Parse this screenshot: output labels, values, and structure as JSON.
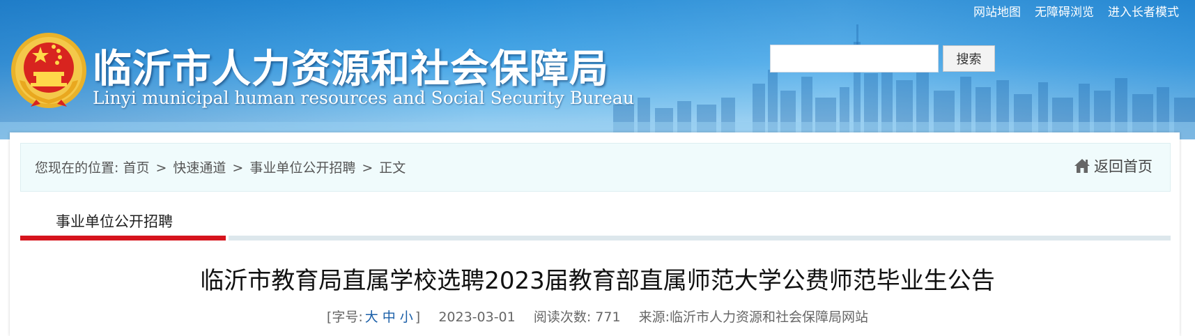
{
  "header": {
    "top_links": [
      "网站地图",
      "无障碍浏览",
      "进入长者模式"
    ],
    "title_cn": "临沂市人力资源和社会保障局",
    "title_en": "Linyi municipal human resources and Social Security Bureau",
    "emblem_icon": "national-emblem-icon",
    "search": {
      "placeholder": "",
      "value": "",
      "button_label": "搜索"
    }
  },
  "breadcrumb": {
    "prefix": "您现在的位置:",
    "items": [
      "首页",
      "快速通道",
      "事业单位公开招聘",
      "正文"
    ],
    "separator": ">",
    "home_link_label": "返回首页",
    "home_icon": "home-icon"
  },
  "section": {
    "tab_label": "事业单位公开招聘",
    "accent_color": "#d6141d"
  },
  "article": {
    "title": "临沂市教育局直属学校选聘2023届教育部直属师范大学公费师范毕业生公告",
    "font_size_open": "[字号:",
    "font_sizes": [
      "大",
      "中",
      "小"
    ],
    "font_size_close": "]",
    "date": "2023-03-01",
    "views_label": "阅读次数:",
    "views": "771",
    "source_label": "来源:",
    "source": "临沂市人力资源和社会保障局网站"
  },
  "colors": {
    "banner_blue": "#3a9be0",
    "link_blue": "#1a5fa8",
    "crumb_bg": "#f0fbfc"
  }
}
